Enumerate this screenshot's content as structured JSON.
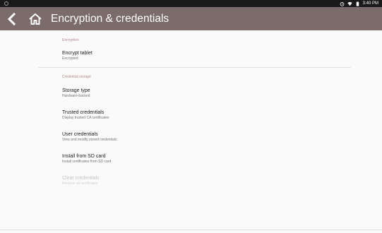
{
  "status_bar": {
    "time": "3:40 PM",
    "icons": [
      "settings-ring-icon",
      "alarm-icon",
      "wifi-icon",
      "battery-icon"
    ]
  },
  "action_bar": {
    "title": "Encryption & credentials",
    "background_color": "#7b6b6b",
    "back_icon": "back-chevron-icon",
    "home_icon": "home-icon"
  },
  "sections": {
    "encryption": {
      "header": "Encryption",
      "items": [
        {
          "title": "Encrypt tablet",
          "summary": "Encrypted"
        }
      ]
    },
    "credential_storage": {
      "header": "Credential storage",
      "items": [
        {
          "title": "Storage type",
          "summary": "Hardware-backed"
        },
        {
          "title": "Trusted credentials",
          "summary": "Display trusted CA certificates"
        },
        {
          "title": "User credentials",
          "summary": "View and modify stored credentials"
        },
        {
          "title": "Install from SD card",
          "summary": "Install certificates from SD card"
        },
        {
          "title": "Clear credentials",
          "summary": "Remove all certificates",
          "enabled": false
        }
      ]
    }
  },
  "colors": {
    "section_header": "#b08a8a",
    "title_text": "#212121",
    "summary_text": "#757575",
    "disabled_text": "#c4c4c4"
  }
}
